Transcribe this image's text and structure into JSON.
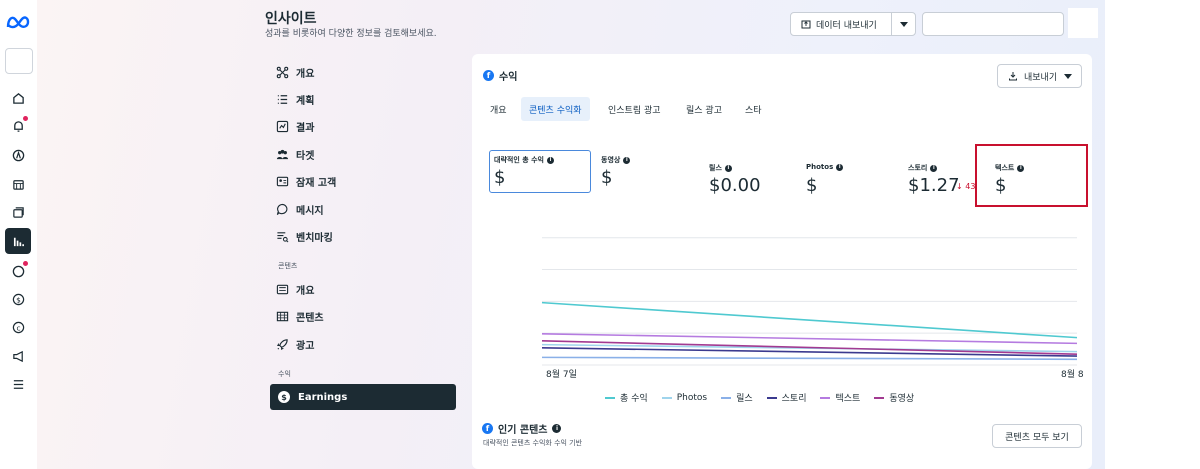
{
  "header": {
    "title": "인사이트",
    "subtitle": "성과를 비롯하여 다양한 정보를 검토해보세요.",
    "export_data_label": "데이터 내보내기"
  },
  "sidebar": {
    "items": [
      {
        "label": "개요",
        "icon": "overview-icon"
      },
      {
        "label": "계획",
        "icon": "plan-list-icon"
      },
      {
        "label": "결과",
        "icon": "results-chart-icon"
      },
      {
        "label": "타겟",
        "icon": "audience-icon"
      },
      {
        "label": "잠재 고객",
        "icon": "potential-customer-icon"
      },
      {
        "label": "메시지",
        "icon": "message-icon"
      },
      {
        "label": "벤치마킹",
        "icon": "benchmark-icon"
      }
    ],
    "content_section": "콘텐츠",
    "content_items": [
      {
        "label": "개요",
        "icon": "content-overview-icon"
      },
      {
        "label": "콘텐츠",
        "icon": "content-grid-icon"
      },
      {
        "label": "광고",
        "icon": "ads-rocket-icon"
      }
    ],
    "revenue_section": "수익",
    "earnings_label": "Earnings"
  },
  "card": {
    "title": "수익",
    "export_label": "내보내기",
    "tabs": [
      "개요",
      "콘텐츠 수익화",
      "인스트림 광고",
      "릴스 광고",
      "스타"
    ],
    "active_tab": 1,
    "metrics": [
      {
        "label": "대략적인 총 수익",
        "value": "$"
      },
      {
        "label": "동영상",
        "value": "$"
      },
      {
        "label": "릴스",
        "value": "$0.00"
      },
      {
        "label": "Photos",
        "value": "$"
      },
      {
        "label": "스토리",
        "value": "$1.27",
        "change": "↓ 43"
      },
      {
        "label": "텍스트",
        "value": "$"
      }
    ],
    "popular_title": "인기 콘텐츠",
    "popular_subtitle": "대략적인 콘텐츠 수익화 수익 기반",
    "view_all_label": "콘텐츠 모두 보기"
  },
  "colors": {
    "accent": "#0a5dc2",
    "highlight": "#c8102e",
    "nav_dark": "#1c2b33"
  },
  "chart_data": {
    "type": "line",
    "x": [
      "8월 7일",
      "8월 8"
    ],
    "series": [
      {
        "name": "총 수익",
        "color": "#4fc9d0",
        "values": [
          0.98,
          0.43
        ]
      },
      {
        "name": "Photos",
        "color": "#9fd4ec",
        "values": [
          0.32,
          0.21
        ]
      },
      {
        "name": "릴스",
        "color": "#8ab0e8",
        "values": [
          0.12,
          0.09
        ]
      },
      {
        "name": "스토리",
        "color": "#3b3a8f",
        "values": [
          0.27,
          0.14
        ]
      },
      {
        "name": "텍스트",
        "color": "#b57be0",
        "values": [
          0.49,
          0.34
        ]
      },
      {
        "name": "동영상",
        "color": "#a23a91",
        "values": [
          0.38,
          0.17
        ]
      }
    ],
    "ylim": [
      0,
      2.2
    ],
    "grid": true
  }
}
